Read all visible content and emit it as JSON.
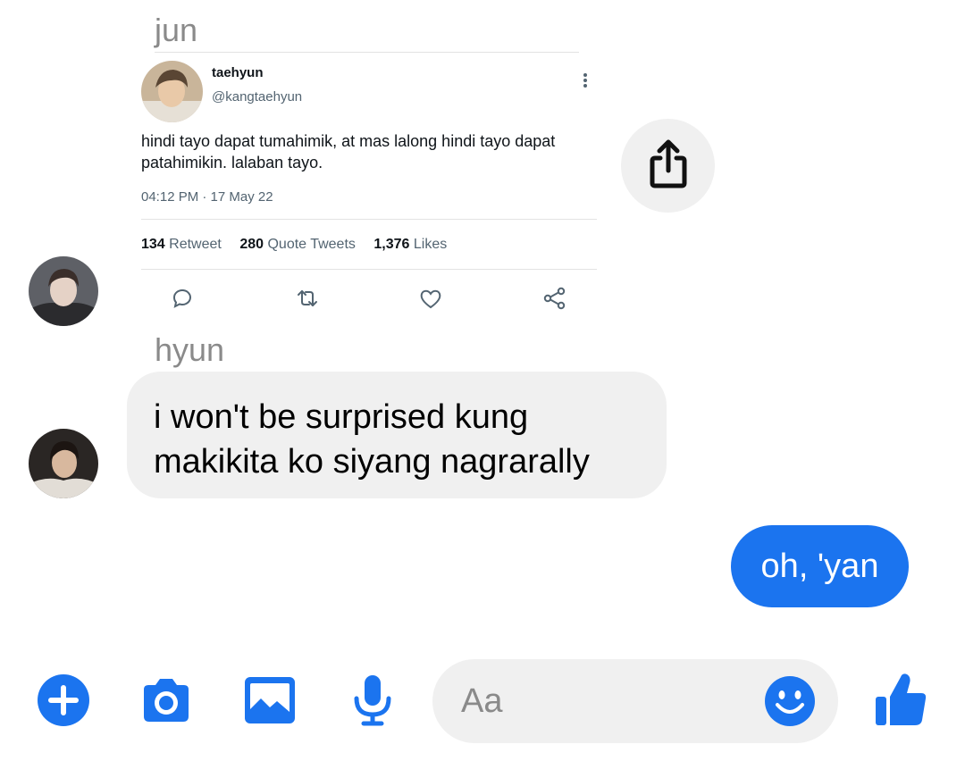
{
  "conversation": {
    "sender1": {
      "name": "jun"
    },
    "tweet": {
      "display_name": "taehyun",
      "handle": "@kangtaehyun",
      "text": "hindi tayo dapat tumahimik, at mas lalong hindi tayo dapat patahimikin. lalaban tayo.",
      "timestamp": "04:12 PM · 17 May 22",
      "retweets_count": "134",
      "retweets_label": "Retweet",
      "quotes_count": "280",
      "quotes_label": "Quote Tweets",
      "likes_count": "1,376",
      "likes_label": "Likes",
      "actions": [
        "reply-icon",
        "retweet-icon",
        "like-icon",
        "share-icon"
      ]
    },
    "sender2": {
      "name": "hyun"
    },
    "incoming_message": "i won't be surprised kung makikita ko siyang nagrarally",
    "outgoing_message": "oh, 'yan"
  },
  "composer": {
    "placeholder": "Aa",
    "tools": [
      "plus-icon",
      "camera-icon",
      "gallery-icon",
      "microphone-icon",
      "emoji-icon",
      "thumbs-up-icon"
    ]
  },
  "colors": {
    "messenger_blue": "#1b74ef",
    "bubble_gray": "#f0f0f0",
    "name_gray": "#8a8a8a",
    "tweet_secondary": "#536471"
  }
}
